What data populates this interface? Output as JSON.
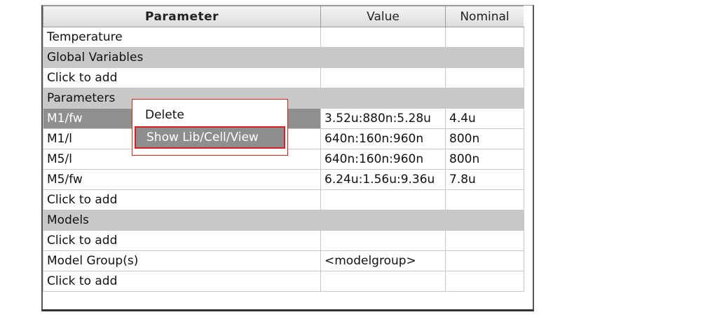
{
  "table": {
    "headers": {
      "parameter": "Parameter",
      "value": "Value",
      "nominal": "Nominal"
    },
    "rows": [
      {
        "type": "item",
        "parameter": "Temperature",
        "value": "",
        "nominal": ""
      },
      {
        "type": "section",
        "parameter": "Global Variables",
        "value": "",
        "nominal": ""
      },
      {
        "type": "placeholder",
        "parameter": "Click to add",
        "value": "",
        "nominal": ""
      },
      {
        "type": "section",
        "parameter": "Parameters",
        "value": "",
        "nominal": ""
      },
      {
        "type": "item",
        "parameter": "M1/fw",
        "value": "3.52u:880n:5.28u",
        "nominal": "4.4u",
        "selected": true
      },
      {
        "type": "item",
        "parameter": "M1/l",
        "value": "640n:160n:960n",
        "nominal": "800n"
      },
      {
        "type": "item",
        "parameter": "M5/l",
        "value": "640n:160n:960n",
        "nominal": "800n"
      },
      {
        "type": "item",
        "parameter": "M5/fw",
        "value": "6.24u:1.56u:9.36u",
        "nominal": "7.8u"
      },
      {
        "type": "placeholder",
        "parameter": "Click to add",
        "value": "",
        "nominal": ""
      },
      {
        "type": "section",
        "parameter": "Models",
        "value": "",
        "nominal": ""
      },
      {
        "type": "placeholder",
        "parameter": "Click to add",
        "value": "",
        "nominal": ""
      },
      {
        "type": "item",
        "parameter": "Model Group(s)",
        "value": "<modelgroup>",
        "value_placeholder": true,
        "nominal": ""
      },
      {
        "type": "placeholder",
        "parameter": "Click to add",
        "value": "",
        "nominal": ""
      }
    ]
  },
  "context_menu": {
    "items": [
      "Delete",
      "Show Lib/Cell/View"
    ],
    "highlighted": "Show Lib/Cell/View"
  },
  "colors": {
    "selection": "#8f8f8f",
    "section_bg": "#c8c8c8",
    "highlight_outline": "#d62020",
    "placeholder_text": "#a2a2a2"
  }
}
